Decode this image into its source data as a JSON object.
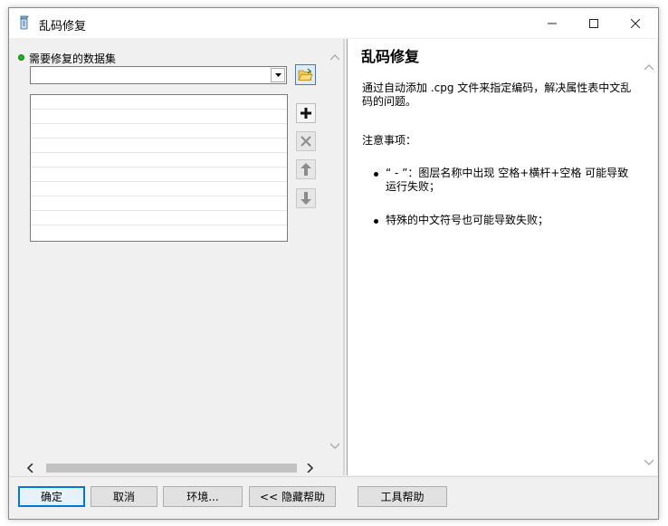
{
  "window": {
    "title": "乱码修复"
  },
  "params": {
    "dataset_label": "需要修复的数据集",
    "dataset_value": "",
    "list_rows": 9
  },
  "help": {
    "title": "乱码修复",
    "description": "通过自动添加 .cpg 文件来指定编码，解决属性表中文乱码的问题。",
    "notes_title": "注意事项：",
    "notes": [
      "“ - ”：图层名称中出现 空格+横杆+空格 可能导致运行失败；",
      "特殊的中文符号也可能导致失败；"
    ]
  },
  "buttons": {
    "ok": "确定",
    "cancel": "取消",
    "env": "环境...",
    "hide_help": "<< 隐藏帮助",
    "tool_help": "工具帮助"
  },
  "colors": {
    "required_dot": "#1fb41f",
    "default_button_border": "#0078d7"
  },
  "icons": {
    "title": "tool-script-icon",
    "browse": "open-folder-icon",
    "add": "plus-icon",
    "remove": "x-icon",
    "up": "arrow-up-icon",
    "down": "arrow-down-icon"
  }
}
